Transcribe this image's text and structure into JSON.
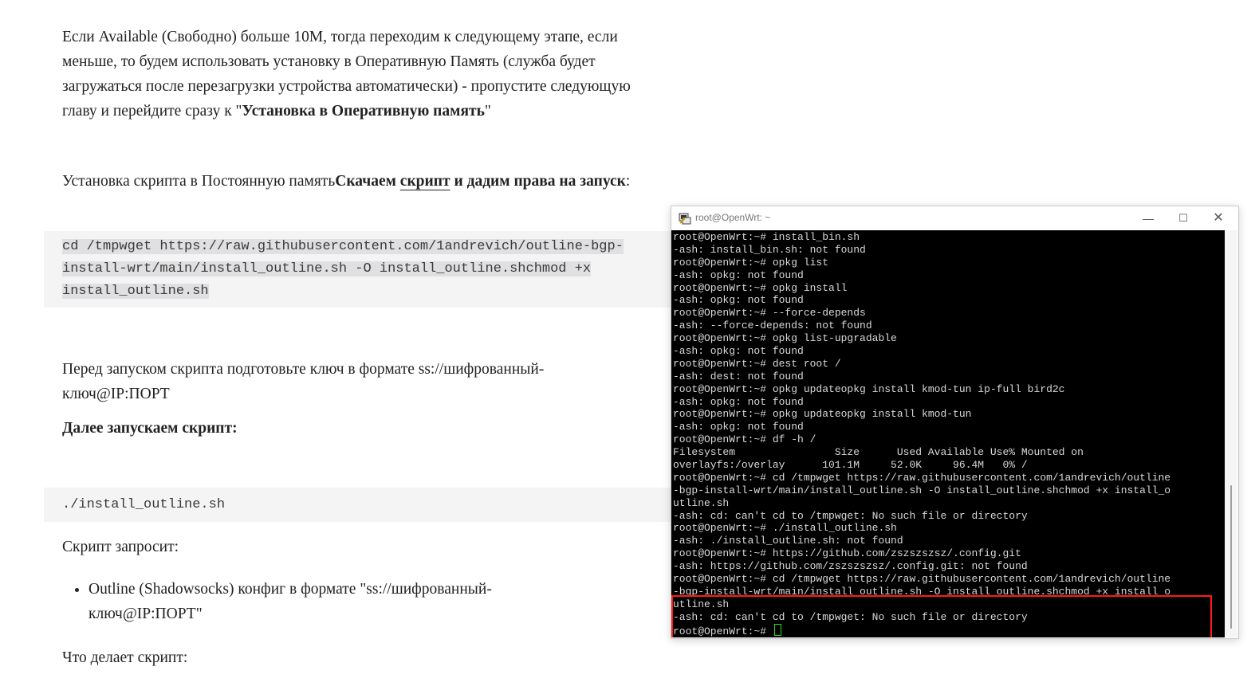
{
  "article": {
    "para1": {
      "text": "Если Available (Свободно) больше 10М, тогда переходим к следующему этапе, если меньше, то будем использовать установку в Оперативную Память (служба будет загружаться после перезагрузки устройства автоматически) - пропустите следующую главу и перейдите сразу к \"",
      "bold": "Установка в Оперативную память",
      "tail": "\""
    },
    "para2": {
      "text": "Установка скрипта в Постоянную память",
      "bold1": "Скачаем ",
      "link": "скрипт",
      "bold2": " и дадим права на запуск",
      "tail": ":"
    },
    "code1": {
      "line1": "cd /tmpwget https://raw.githubusercontent.com/1andrevich/outline-bgp-",
      "line2": "install-wrt/main/install_outline.sh -O install_outline.shchmod +x",
      "line3": "install_outline.sh"
    },
    "para3": "Перед запуском скрипта подготовьте ключ в формате ss://шифрованный-ключ@IP:ПОРТ",
    "para4": "Далее запускаем скрипт:",
    "code2": "./install_outline.sh",
    "para5": "Скрипт запросит:",
    "bullets": [
      "Outline (Shadowsocks) конфиг в формате \"ss://шифрованный-ключ@IP:ПОРТ\""
    ],
    "para6": "Что делает скрипт:"
  },
  "terminal": {
    "title": "root@OpenWrt: ~",
    "buttons": {
      "minimize": "—",
      "maximize": "☐",
      "close": "✕"
    },
    "lines": [
      "root@OpenWrt:~# install_bin.sh",
      "-ash: install_bin.sh: not found",
      "root@OpenWrt:~# opkg list",
      "-ash: opkg: not found",
      "root@OpenWrt:~# opkg install",
      "-ash: opkg: not found",
      "root@OpenWrt:~# --force-depends",
      "-ash: --force-depends: not found",
      "root@OpenWrt:~# opkg list-upgradable",
      "-ash: opkg: not found",
      "root@OpenWrt:~# dest root /",
      "-ash: dest: not found",
      "root@OpenWrt:~# opkg updateopkg install kmod-tun ip-full bird2c",
      "-ash: opkg: not found",
      "root@OpenWrt:~# opkg updateopkg install kmod-tun",
      "-ash: opkg: not found",
      "root@OpenWrt:~# df -h /",
      "Filesystem                Size      Used Available Use% Mounted on",
      "overlayfs:/overlay      101.1M     52.0K     96.4M   0% /",
      "root@OpenWrt:~# cd /tmpwget https://raw.githubusercontent.com/1andrevich/outline",
      "-bgp-install-wrt/main/install_outline.sh -O install_outline.shchmod +x install_o",
      "utline.sh",
      "-ash: cd: can't cd to /tmpwget: No such file or directory",
      "root@OpenWrt:~# ./install_outline.sh",
      "-ash: ./install_outline.sh: not found",
      "root@OpenWrt:~# https://github.com/zszszszsz/.config.git",
      "-ash: https://github.com/zszszszsz/.config.git: not found",
      "root@OpenWrt:~# cd /tmpwget https://raw.githubusercontent.com/1andrevich/outline",
      "-bgp-install-wrt/main/install_outline.sh -O install_outline.shchmod +x install_o",
      "utline.sh",
      "-ash: cd: can't cd to /tmpwget: No such file or directory"
    ],
    "prompt": "root@OpenWrt:~# ",
    "colors": {
      "background": "#000000",
      "text": "#d9d9d9",
      "cursor": "#22dd22",
      "highlight_box": "#ff1a1a"
    }
  }
}
